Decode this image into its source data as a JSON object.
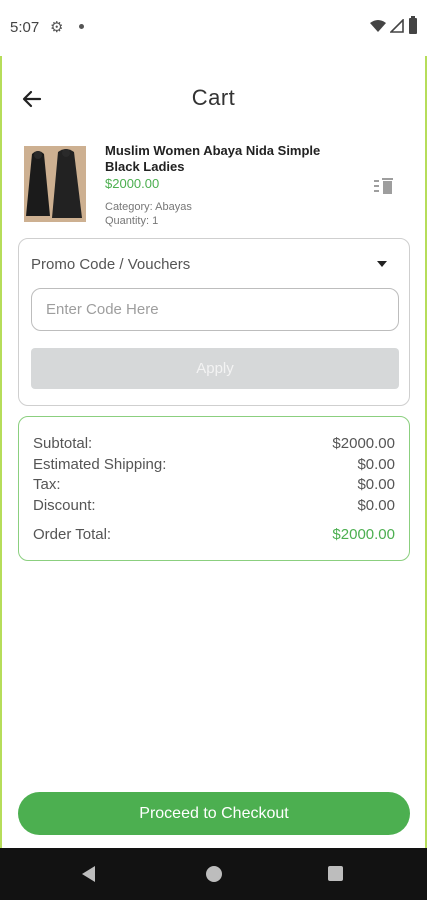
{
  "status_bar": {
    "time": "5:07",
    "icons": [
      "gear-icon",
      "notification-dot-icon",
      "wifi-icon",
      "signal-icon",
      "battery-icon"
    ]
  },
  "app_bar": {
    "title": "Cart",
    "back_icon": "arrow-left-icon"
  },
  "cart_item": {
    "name": "Muslim Women Abaya Nida Simple Black Ladies",
    "price": "$2000.00",
    "category_label": "Category:",
    "category_value": "Abayas",
    "quantity_label": "Quantity:",
    "quantity_value": "1",
    "delete_icon": "trash-icon"
  },
  "promo": {
    "header": "Promo Code / Vouchers",
    "input_value": "",
    "input_placeholder": "Enter Code Here",
    "apply_label": "Apply"
  },
  "summary": {
    "subtotal_label": "Subtotal:",
    "subtotal_value": "$2000.00",
    "shipping_label": "Estimated Shipping:",
    "shipping_value": "$0.00",
    "tax_label": "Tax:",
    "tax_value": "$0.00",
    "discount_label": "Discount:",
    "discount_value": "$0.00",
    "total_label": "Order Total:",
    "total_value": "$2000.00"
  },
  "checkout": {
    "label": "Proceed to Checkout"
  },
  "colors": {
    "accent": "#4caf50",
    "border_green": "#8bcf7f",
    "disabled_button": "#d6d8d9",
    "nav_bar": "#121212"
  }
}
